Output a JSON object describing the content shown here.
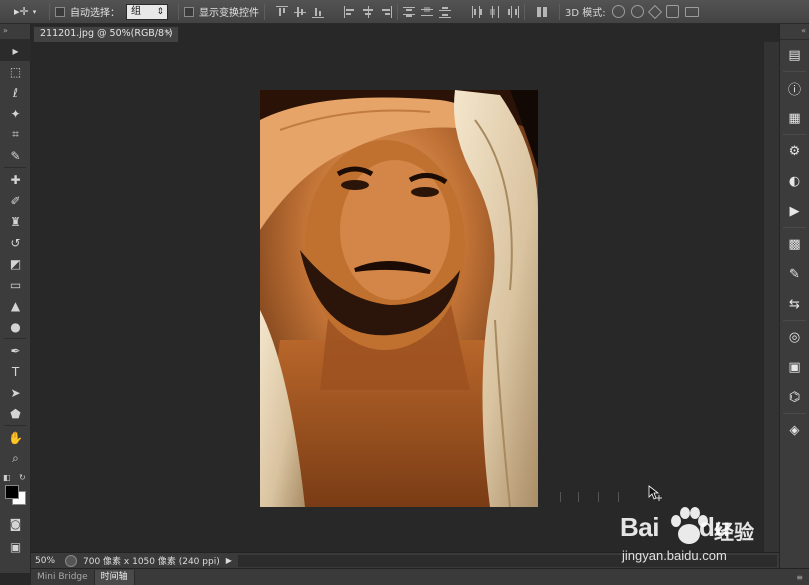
{
  "options_bar": {
    "tool_glyph": "▸✛",
    "auto_select_label": "自动选择：",
    "auto_select_value": "组",
    "show_transform_label": "显示变换控件",
    "mode_3d_label": "3D 模式:"
  },
  "document": {
    "tab_title": "211201.jpg @ 50%(RGB/8*)",
    "close_glyph": "×"
  },
  "status_bar": {
    "zoom": "50%",
    "doc_info": "700 像素 x 1050 像素 (240 ppi)",
    "menu_arrow": "▶"
  },
  "bottom_tabs": [
    {
      "label": "Mini Bridge"
    },
    {
      "label": "时间轴"
    }
  ],
  "left_tools": [
    {
      "name": "move-tool",
      "glyph": "▸"
    },
    {
      "name": "marquee-tool",
      "glyph": "⬚"
    },
    {
      "name": "lasso-tool",
      "glyph": "ℓ"
    },
    {
      "name": "quick-select-tool",
      "glyph": "✦"
    },
    {
      "name": "crop-tool",
      "glyph": "⌗"
    },
    {
      "name": "eyedropper-tool",
      "glyph": "✎"
    },
    {
      "name": "healing-brush-tool",
      "glyph": "✚"
    },
    {
      "name": "brush-tool",
      "glyph": "✐"
    },
    {
      "name": "clone-stamp-tool",
      "glyph": "♜"
    },
    {
      "name": "history-brush-tool",
      "glyph": "↺"
    },
    {
      "name": "eraser-tool",
      "glyph": "◩"
    },
    {
      "name": "gradient-tool",
      "glyph": "▭"
    },
    {
      "name": "blur-tool",
      "glyph": "▲"
    },
    {
      "name": "dodge-tool",
      "glyph": "●"
    },
    {
      "name": "pen-tool",
      "glyph": "✒"
    },
    {
      "name": "type-tool",
      "glyph": "T"
    },
    {
      "name": "path-select-tool",
      "glyph": "➤"
    },
    {
      "name": "shape-tool",
      "glyph": "⬟"
    },
    {
      "name": "hand-tool",
      "glyph": "✋"
    },
    {
      "name": "zoom-tool",
      "glyph": "⌕"
    }
  ],
  "right_panels": [
    {
      "name": "history-panel-icon",
      "glyph": "▤"
    },
    {
      "name": "info-panel-icon",
      "glyph": "ⓘ"
    },
    {
      "name": "properties-panel-icon",
      "glyph": "▦"
    },
    {
      "name": "brush-panel-icon",
      "glyph": "⚙"
    },
    {
      "name": "adjustments-panel-icon",
      "glyph": "◐"
    },
    {
      "name": "actions-panel-icon",
      "glyph": "▶"
    },
    {
      "name": "swatches-panel-icon",
      "glyph": "▩"
    },
    {
      "name": "brush-presets-panel-icon",
      "glyph": "✎"
    },
    {
      "name": "clone-source-panel-icon",
      "glyph": "⇆"
    },
    {
      "name": "channels-panel-icon",
      "glyph": "◎"
    },
    {
      "name": "styles-panel-icon",
      "glyph": "▣"
    },
    {
      "name": "paths-panel-icon",
      "glyph": "⌬"
    },
    {
      "name": "layers-panel-icon",
      "glyph": "◈"
    }
  ],
  "watermark": {
    "brand": "Bai",
    "brand_suffix": "du",
    "cn_label": "经验",
    "url": "jingyan.baidu.com"
  },
  "colors": {
    "foreground": "#000000",
    "background": "#ffffff",
    "ui_dark": "#282828",
    "panel": "#3c3c3c"
  }
}
